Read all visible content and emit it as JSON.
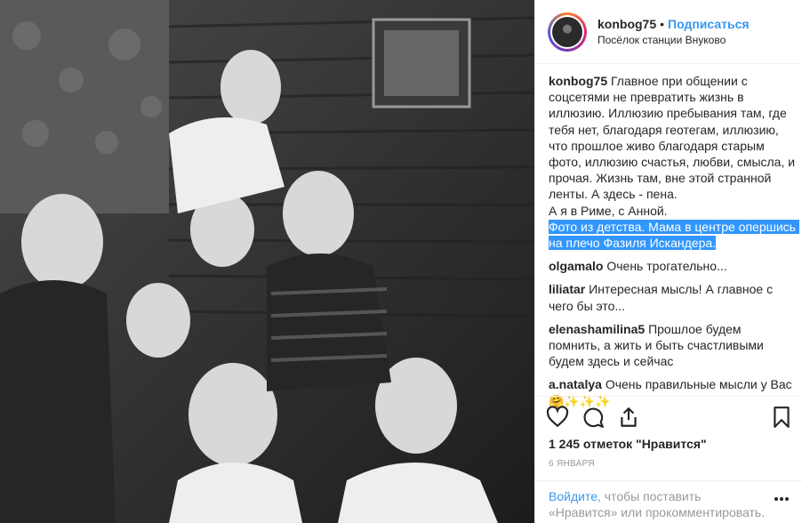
{
  "post": {
    "username": "konbog75",
    "separator": "•",
    "follow_label": "Подписаться",
    "location": "Посёлок станции Внуково",
    "photo_alt": "Фото из детства"
  },
  "caption": {
    "username": "konbog75",
    "text": "Главное при общении с соцсетями не превратить жизнь в иллюзию. Иллюзию пребывания там, где тебя нет, благодаря геотегам, иллюзию, что прошлое живо благодаря старым фото, иллюзию счастья, любви, смысла, и прочая. Жизнь там, вне этой странной ленты. А здесь - пена.\nА я в Риме, с Анной.",
    "selected_text": "Фото из детства. Мама в центре опершись на плечо Фазиля Искандера."
  },
  "comments": [
    {
      "username": "olgamalo",
      "text": "Очень трогательно..."
    },
    {
      "username": "liliatar",
      "text": "Интересная мысль! А главное с чего бы это..."
    },
    {
      "username": "elenashamilina5",
      "text": "Прошлое будем помнить, а жить и быть счастливыми будем здесь и сейчас"
    },
    {
      "username": "a.natalya",
      "text": "Очень правильные мысли у Вас 🤗✨✨✨"
    }
  ],
  "actions": {
    "icons": [
      "heart-icon",
      "comment-icon",
      "share-icon",
      "bookmark-icon"
    ]
  },
  "likes_text": "1 245 отметок \"Нравится\"",
  "date_text": "6 ЯНВАРЯ",
  "footer": {
    "login_label": "Войдите",
    "rest_text": ", чтобы поставить «Нравится» или прокомментировать.",
    "more_icon": "more-icon"
  },
  "colors": {
    "link": "#3897f0",
    "selection": "#3297fd",
    "text": "#262626",
    "muted": "#999999"
  }
}
